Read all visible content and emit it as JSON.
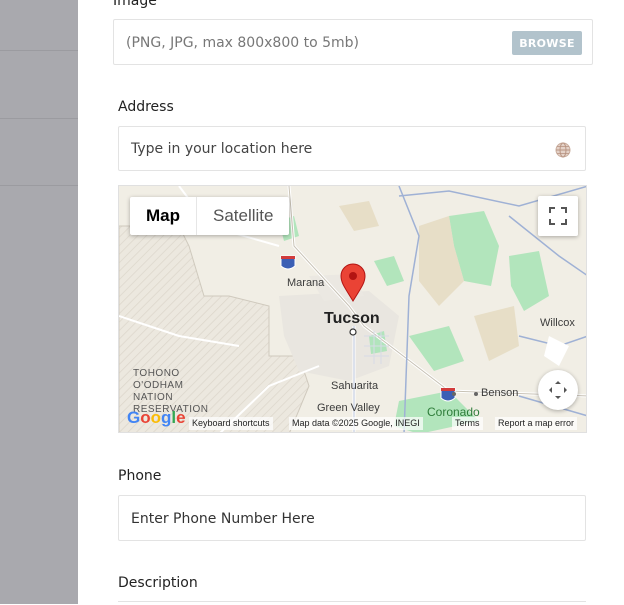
{
  "form": {
    "image": {
      "label": "Image",
      "placeholder": "(PNG, JPG, max 800x800 to 5mb)",
      "browse_label": "BROWSE"
    },
    "address": {
      "label": "Address",
      "placeholder": "Type in your location here"
    },
    "phone": {
      "label": "Phone",
      "placeholder": "Enter Phone Number Here"
    },
    "description": {
      "label": "Description"
    }
  },
  "map": {
    "type_buttons": {
      "map": "Map",
      "satellite": "Satellite"
    },
    "places": {
      "tucson": "Tucson",
      "marana": "Marana",
      "willcox": "Willcox",
      "sahuarita": "Sahuarita",
      "green_valley": "Green Valley",
      "benson": "Benson",
      "coronado": "Coronado",
      "reservation": [
        "TOHONO",
        "O'ODHAM",
        "NATION",
        "RESERVATION"
      ]
    },
    "highway": "10",
    "attribution": {
      "shortcuts": "Keyboard shortcuts",
      "data": "Map data ©2025 Google, INEGI",
      "terms": "Terms",
      "report": "Report a map error"
    },
    "logo": "Google",
    "icons": [
      "fullscreen-icon",
      "camera-control-icon",
      "map-pin-icon",
      "globe-icon"
    ],
    "colors": {
      "pin": "#ea4335",
      "park": "#a7e3b5",
      "road": "#ffffff",
      "highway_shield": "#3b5fb5"
    }
  }
}
